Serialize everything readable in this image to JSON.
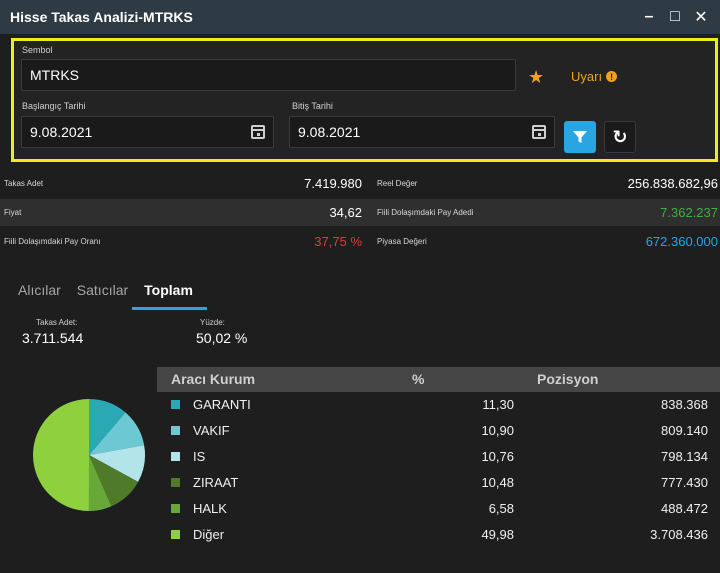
{
  "window": {
    "title": "Hisse Takas Analizi-MTRKS",
    "minimize_glyph": "–",
    "maximize_glyph": "□",
    "close_glyph": "✕"
  },
  "filters": {
    "symbol_label": "Sembol",
    "symbol_value": "MTRKS",
    "favorite_icon": "star-icon",
    "alert_label": "Uyarı",
    "alert_info_glyph": "!",
    "start_label": "Başlangıç Tarihi",
    "start_value": "9.08.2021",
    "end_label": "Bitiş Tarihi",
    "end_value": "9.08.2021",
    "refresh_glyph": "↻"
  },
  "stats": {
    "takas_adet_label": "Takas Adet",
    "takas_adet_value": "7.419.980",
    "reel_deger_label": "Reel Değer",
    "reel_deger_value": "256.838.682,96",
    "fiyat_label": "Fiyat",
    "fiyat_value": "34,62",
    "fiili_pay_adedi_label": "Fiili Dolaşımdaki Pay Adedi",
    "fiili_pay_adedi_value": "7.362.237",
    "fiili_pay_orani_label": "Fiili Dolaşımdaki Pay Oranı",
    "fiili_pay_orani_value": "37,75 %",
    "piyasa_degeri_label": "Piyasa Değeri",
    "piyasa_degeri_value": "672.360.000"
  },
  "tabs": [
    {
      "label": "Alıcılar"
    },
    {
      "label": "Satıcılar"
    },
    {
      "label": "Toplam"
    }
  ],
  "summary": {
    "takas_label": "Takas Adet:",
    "takas_value": "3.711.544",
    "yuzde_label": "Yüzde:",
    "yuzde_value": "50,02 %"
  },
  "table": {
    "columns": [
      "Aracı Kurum",
      "%",
      "Pozisyon"
    ],
    "rows": [
      {
        "name": "GARANTI",
        "pct": "11,30",
        "pos": "838.368",
        "color": "#2aa8b4"
      },
      {
        "name": "VAKIF",
        "pct": "10,90",
        "pos": "809.140",
        "color": "#6cc8d2"
      },
      {
        "name": "IS",
        "pct": "10,76",
        "pos": "798.134",
        "color": "#b2e4ea"
      },
      {
        "name": "ZIRAAT",
        "pct": "10,48",
        "pos": "777.430",
        "color": "#4e7a2a"
      },
      {
        "name": "HALK",
        "pct": "6,58",
        "pos": "488.472",
        "color": "#68a838"
      },
      {
        "name": "Diğer",
        "pct": "49,98",
        "pos": "3.708.436",
        "color": "#8ed03e"
      }
    ]
  },
  "colors": {
    "accent": "#29a6e1",
    "highlight_border": "#f2ea1d",
    "green": "#3cb043",
    "red": "#e03a3a",
    "blue": "#29a6e1",
    "orange": "#f0a020"
  },
  "chart_data": {
    "type": "pie",
    "categories": [
      "GARANTI",
      "VAKIF",
      "IS",
      "ZIRAAT",
      "HALK",
      "Diğer"
    ],
    "values": [
      11.3,
      10.9,
      10.76,
      10.48,
      6.58,
      49.98
    ]
  }
}
